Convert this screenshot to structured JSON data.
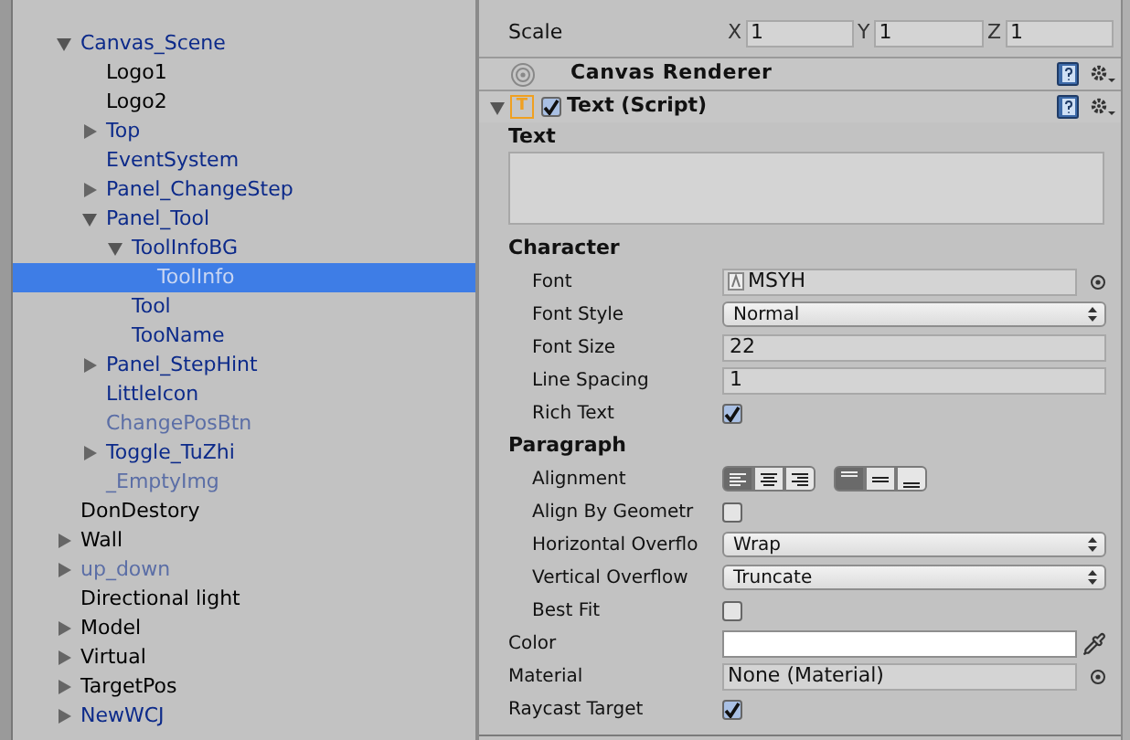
{
  "hierarchy": {
    "items": [
      {
        "label": "Canvas_Scene",
        "kind": "prefab",
        "selected": false,
        "expanded": true,
        "children": [
          {
            "label": "Logo1",
            "kind": "object",
            "selected": false
          },
          {
            "label": "Logo2",
            "kind": "object",
            "selected": false
          },
          {
            "label": "Top",
            "kind": "prefab",
            "selected": false,
            "expanded": false
          },
          {
            "label": "EventSystem",
            "kind": "prefab",
            "selected": false
          },
          {
            "label": "Panel_ChangeStep",
            "kind": "prefab",
            "selected": false,
            "expanded": false
          },
          {
            "label": "Panel_Tool",
            "kind": "prefab",
            "selected": false,
            "expanded": true,
            "children": [
              {
                "label": "ToolInfoBG",
                "kind": "prefab",
                "selected": false,
                "expanded": true,
                "children": [
                  {
                    "label": "ToolInfo",
                    "kind": "prefab",
                    "selected": true
                  }
                ]
              },
              {
                "label": "Tool",
                "kind": "prefab",
                "selected": false
              },
              {
                "label": "TooName",
                "kind": "prefab",
                "selected": false
              }
            ]
          },
          {
            "label": "Panel_StepHint",
            "kind": "prefab",
            "selected": false,
            "expanded": false
          },
          {
            "label": "LittleIcon",
            "kind": "prefab",
            "selected": false
          },
          {
            "label": "ChangePosBtn",
            "kind": "prefab_inactive",
            "selected": false
          },
          {
            "label": "Toggle_TuZhi",
            "kind": "prefab",
            "selected": false,
            "expanded": false
          },
          {
            "label": "_EmptyImg",
            "kind": "prefab_inactive",
            "selected": false
          }
        ]
      },
      {
        "label": "DonDestory",
        "kind": "object",
        "selected": false
      },
      {
        "label": "Wall",
        "kind": "object",
        "selected": false,
        "expanded": false
      },
      {
        "label": "up_down",
        "kind": "prefab_inactive",
        "selected": false,
        "expanded": false
      },
      {
        "label": "Directional light",
        "kind": "object",
        "selected": false
      },
      {
        "label": "Model",
        "kind": "object",
        "selected": false,
        "expanded": false
      },
      {
        "label": "Virtual",
        "kind": "object",
        "selected": false,
        "expanded": false
      },
      {
        "label": "TargetPos",
        "kind": "object",
        "selected": false,
        "expanded": false
      },
      {
        "label": "NewWCJ",
        "kind": "prefab",
        "selected": false,
        "expanded": false
      }
    ]
  },
  "inspector": {
    "scale": {
      "label": "Scale",
      "axes": [
        {
          "axis": "X",
          "value": "1"
        },
        {
          "axis": "Y",
          "value": "1"
        },
        {
          "axis": "Z",
          "value": "1"
        }
      ]
    },
    "canvas_renderer": {
      "title": "Canvas Renderer"
    },
    "text_script": {
      "icon_letter": "T",
      "title": "Text (Script)",
      "enabled": true,
      "expanded": true,
      "text_label": "Text",
      "properties": [
        {
          "kind": "section",
          "label": "Character",
          "children": [
            {
              "kind": "object_field",
              "label": "Font",
              "value": "MSYH"
            },
            {
              "kind": "dropdown",
              "label": "Font Style",
              "value": "Normal"
            },
            {
              "kind": "number",
              "label": "Font Size",
              "value": "22"
            },
            {
              "kind": "number",
              "label": "Line Spacing",
              "value": "1"
            },
            {
              "kind": "checkbox",
              "label": "Rich Text",
              "checked": true
            }
          ]
        },
        {
          "kind": "section",
          "label": "Paragraph",
          "children": [
            {
              "kind": "alignment",
              "label": "Alignment",
              "horizontal": [
                {
                  "selected": true
                },
                {
                  "selected": false
                },
                {
                  "selected": false
                }
              ],
              "vertical": [
                {
                  "selected": true
                },
                {
                  "selected": false
                },
                {
                  "selected": false
                }
              ]
            },
            {
              "kind": "checkbox",
              "label": "Align By Geometr",
              "checked": false
            },
            {
              "kind": "dropdown",
              "label": "Horizontal Overflo",
              "value": "Wrap"
            },
            {
              "kind": "dropdown",
              "label": "Vertical Overflow",
              "value": "Truncate"
            },
            {
              "kind": "checkbox",
              "label": "Best Fit",
              "checked": false
            }
          ]
        },
        {
          "kind": "color",
          "label": "Color",
          "color": "#ffffff"
        },
        {
          "kind": "object_field",
          "label": "Material",
          "value": "None (Material)"
        },
        {
          "kind": "checkbox",
          "label": "Raycast Target",
          "checked": true
        }
      ]
    }
  }
}
